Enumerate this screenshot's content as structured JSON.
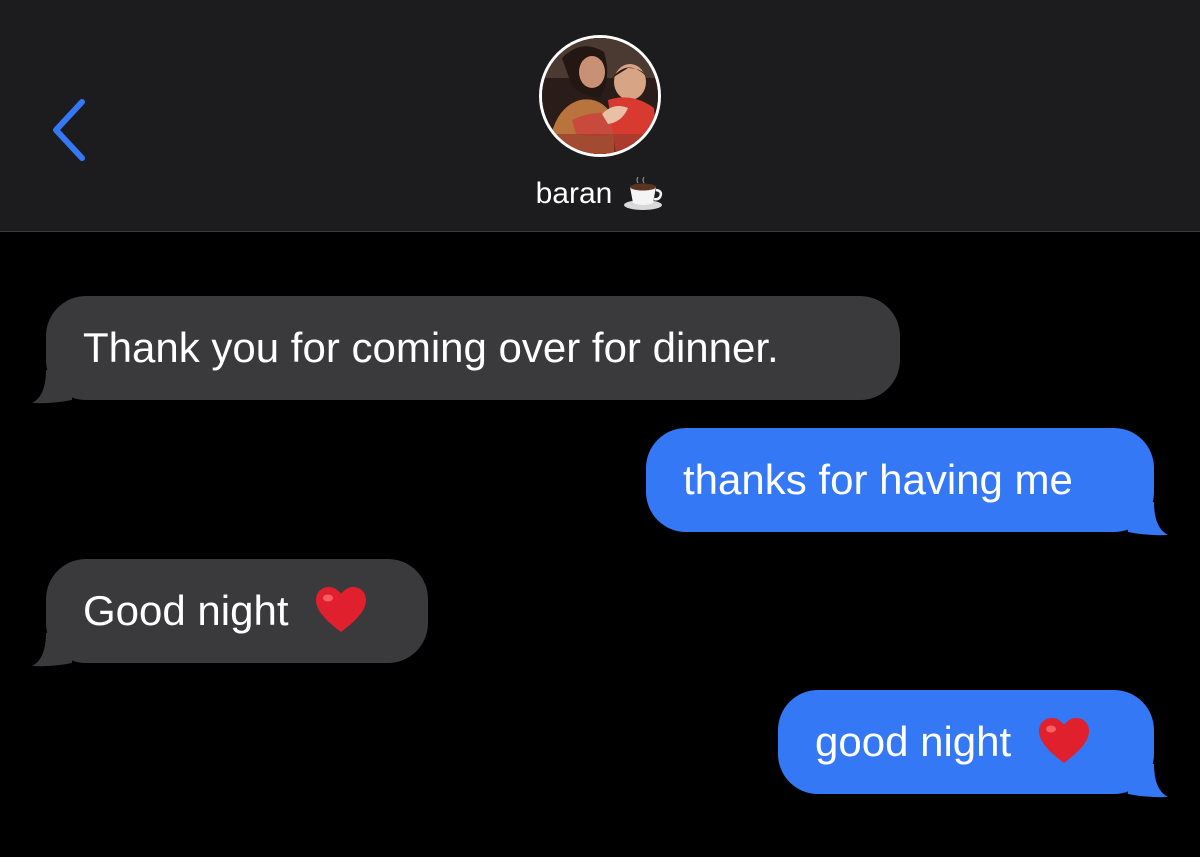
{
  "header": {
    "back_icon": "chevron-left-icon",
    "contact_name": "baran",
    "contact_emoji": "☕"
  },
  "colors": {
    "header_bg": "#1c1c1e",
    "accent": "#3478f6",
    "received_bubble": "#3a3a3c",
    "sent_bubble": "#3478f6",
    "heart": "#e0202c"
  },
  "messages": [
    {
      "direction": "received",
      "text": "Thank you for coming over for dinner."
    },
    {
      "direction": "sent",
      "text": "thanks for having me"
    },
    {
      "direction": "received",
      "text": "Good night",
      "emoji": "❤️"
    },
    {
      "direction": "sent",
      "text": "good night",
      "emoji": "❤️"
    }
  ]
}
